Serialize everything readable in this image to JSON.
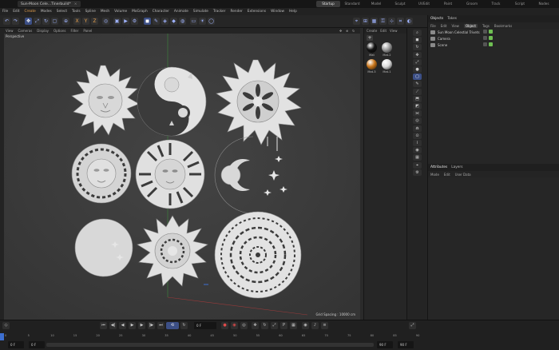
{
  "window": {
    "doc_tab": "Sun-Moon Cele...Tinerbuild*",
    "layouts": [
      "Startup",
      "Standard",
      "Model",
      "Sculpt",
      "UVEdit",
      "Paint",
      "Groom",
      "Track",
      "Script",
      "Nodes"
    ],
    "active_layout": "Startup"
  },
  "menu": [
    "File",
    "Edit",
    "Create",
    "Modes",
    "Select",
    "Tools",
    "Spline",
    "Mesh",
    "Volume",
    "MoGraph",
    "Character",
    "Animate",
    "Simulate",
    "Tracker",
    "Render",
    "Extensions",
    "Window",
    "Help"
  ],
  "viewport": {
    "menu": [
      "View",
      "Cameras",
      "Display",
      "Options",
      "Filter",
      "Panel"
    ],
    "label": "Perspective",
    "grid_spacing": "Grid Spacing : 10000 cm"
  },
  "materials": {
    "tabs": [
      "Create",
      "Edit",
      "View"
    ],
    "items": [
      {
        "name": "Mat",
        "color": "#141414"
      },
      {
        "name": "Mat.2",
        "color": "#9a9a9a"
      },
      {
        "name": "Mat.3",
        "color": "#c9761b"
      },
      {
        "name": "Mat.1",
        "color": "#dddddd"
      }
    ]
  },
  "objects": {
    "tabs": [
      "Objects",
      "Takes"
    ],
    "menu": [
      "File",
      "Edit",
      "View",
      "Object",
      "Tags",
      "Bookmarks"
    ],
    "active_menu": "Object",
    "rows": [
      "Sun Moon Celestial Trivets",
      "Camera",
      "Scene"
    ]
  },
  "attributes": {
    "tabs": [
      "Attributes",
      "Layers"
    ],
    "menu": [
      "Mode",
      "Edit",
      "User Data"
    ]
  },
  "timeline": {
    "current_frame_field": "0 F",
    "start_field": "0 F",
    "end_field": "90 F",
    "min_field": "0 F",
    "max_field": "90 F",
    "ticks": [
      "0",
      "5",
      "10",
      "15",
      "20",
      "25",
      "30",
      "35",
      "40",
      "45",
      "50",
      "55",
      "60",
      "65",
      "70",
      "75",
      "80",
      "85",
      "90"
    ]
  },
  "colors": {
    "accent": "#3c4f86",
    "highlight": "#e7a04d",
    "viewport": "#3b3b3b",
    "model": "#e6e6e6"
  }
}
